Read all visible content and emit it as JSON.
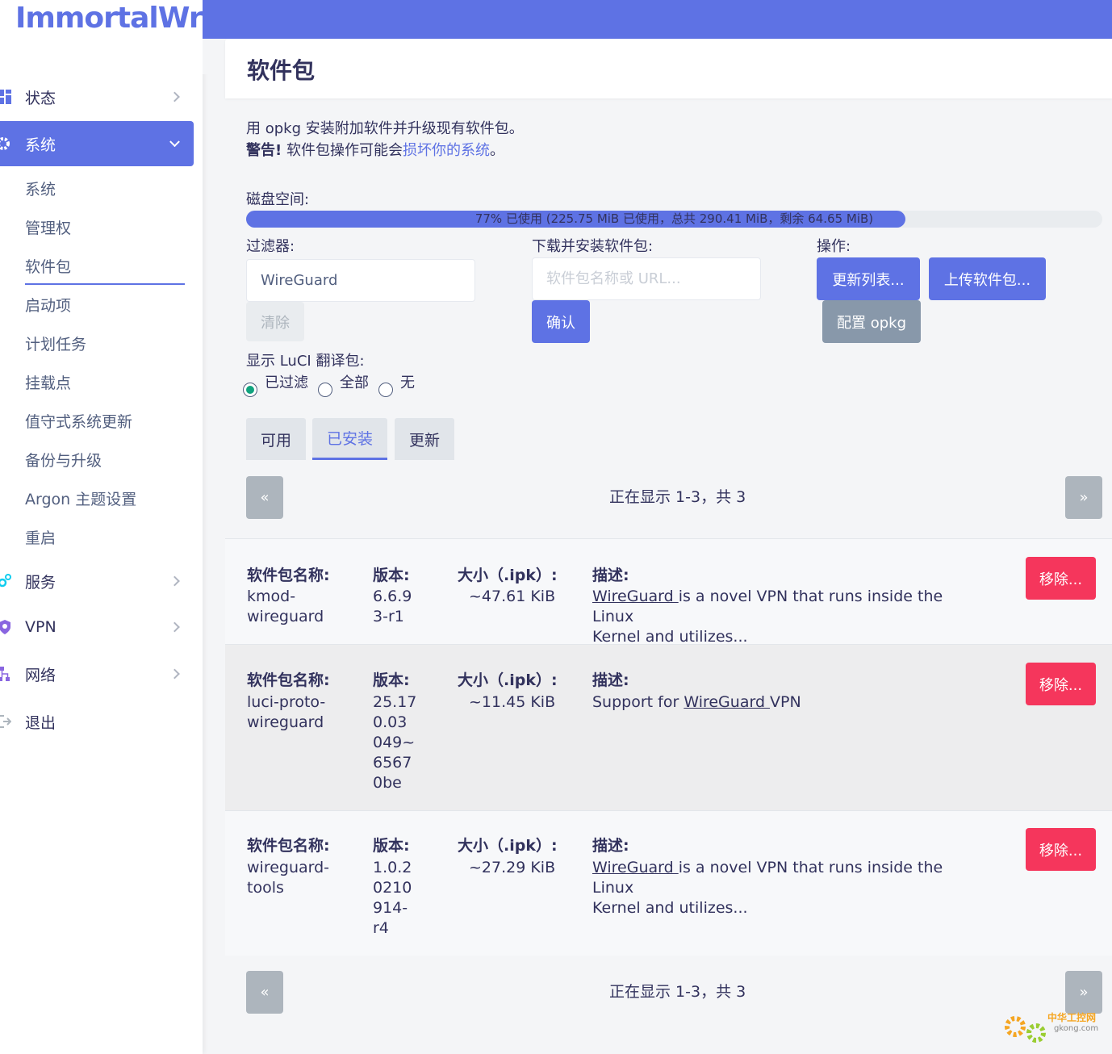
{
  "brand": "ImmortalWrt",
  "sidebar": {
    "items": [
      {
        "label": "状态"
      },
      {
        "label": "系统"
      },
      {
        "label": "服务"
      },
      {
        "label": "VPN"
      },
      {
        "label": "网络"
      },
      {
        "label": "退出"
      }
    ],
    "subitems": [
      "系统",
      "管理权",
      "软件包",
      "启动项",
      "计划任务",
      "挂载点",
      "值守式系统更新",
      "备份与升级",
      "Argon 主题设置",
      "重启"
    ]
  },
  "page": {
    "title": "软件包",
    "intro": "用 opkg 安装附加软件并升级现有软件包。",
    "warning_strong": "警告!",
    "warning_text": "软件包操作可能会",
    "warning_link": "损坏你的系统",
    "warning_end": "。"
  },
  "disk": {
    "label": "磁盘空间:",
    "used_percent": 77,
    "text": "77% 已使用 (225.75 MiB 已使用，总共 290.41 MiB，剩余 64.65 MiB)"
  },
  "filter": {
    "label": "过滤器:",
    "value": "WireGuard",
    "clear_label": "清除"
  },
  "download": {
    "label": "下载并安装软件包:",
    "placeholder": "软件包名称或 URL...",
    "confirm_label": "确认"
  },
  "actions": {
    "label": "操作:",
    "update_lists": "更新列表...",
    "upload_package": "上传软件包...",
    "configure_opkg": "配置 opkg"
  },
  "luci_translation": {
    "label": "显示 LuCI 翻译包:",
    "options": [
      "已过滤",
      "全部",
      "无"
    ],
    "selected": "已过滤"
  },
  "tabs": [
    "可用",
    "已安装",
    "更新"
  ],
  "pager": {
    "prev": "«",
    "next": "»",
    "text": "正在显示 1-3，共 3"
  },
  "table": {
    "headers": {
      "name": "软件包名称:",
      "version": "版本:",
      "size": "大小（.ipk）:",
      "desc": "描述:"
    },
    "remove_label": "移除...",
    "rows": [
      {
        "name_l1": "kmod-",
        "name_l2": "wireguard",
        "version_lines": [
          "6.6.9",
          "3-r1"
        ],
        "size": "~47.61 KiB",
        "desc_link": "WireGuard ",
        "desc_rest_l1": "is a novel VPN that runs inside the Linux",
        "desc_l2": "Kernel and utilizes..."
      },
      {
        "name_l1": "luci-proto-",
        "name_l2": "wireguard",
        "version_lines": [
          "25.17",
          "0.03",
          "049~",
          "6567",
          "0be"
        ],
        "size": "~11.45 KiB",
        "desc_pre": "Support for ",
        "desc_link": "WireGuard ",
        "desc_post": "VPN"
      },
      {
        "name_l1": "wireguard-",
        "name_l2": "tools",
        "version_lines": [
          "1.0.2",
          "0210",
          "914-",
          "r4"
        ],
        "size": "~27.29 KiB",
        "desc_link": "WireGuard ",
        "desc_rest_l1": "is a novel VPN that runs inside the Linux",
        "desc_l2": "Kernel and utilizes..."
      }
    ]
  },
  "watermark": {
    "title": "中华工控网",
    "site": "gkong.com"
  },
  "colors": {
    "accent": "#5e72e4",
    "danger": "#f5365c",
    "gray_button": "#8898aa"
  }
}
